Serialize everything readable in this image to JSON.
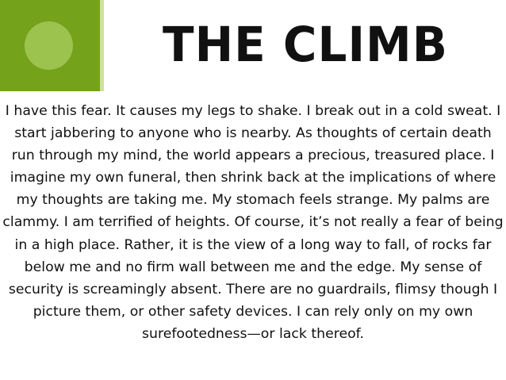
{
  "slide": {
    "title": "THE CLIMB",
    "body": "I have this fear. It causes my legs to shake. I break out in a cold sweat. I start jabbering to anyone who is nearby. As thoughts of certain death run through my mind, the world appears a precious, treasured place. I imagine my own funeral,  then shrink back at the implications of where my thoughts are taking me. My stomach feels strange. My palms are clammy. I am terrified of heights. Of course, it’s not really a fear of being in a high place. Rather, it is the view of a long way to fall, of rocks far below me and no firm wall between me and the edge. My sense of security is screamingly absent. There are no guardrails, flimsy though I picture them, or other safety devices. I can rely only on my own surefootedness—or lack thereof."
  },
  "colors": {
    "accent_square": "#74a21b",
    "accent_circle": "#9dc34f",
    "accent_strip": "#cfe19d",
    "text": "#111111"
  }
}
